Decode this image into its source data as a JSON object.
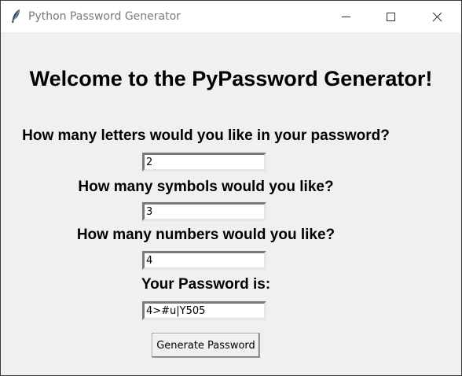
{
  "window": {
    "title": "Python Password Generator",
    "app_icon": "feather-icon",
    "controls": [
      "minimize-icon",
      "maximize-icon",
      "close-icon"
    ]
  },
  "main": {
    "heading": "Welcome to the PyPassword Generator!",
    "letters_label": "How many letters would you like in your password?",
    "letters_value": "2",
    "symbols_label": "How many symbols would you like?",
    "symbols_value": "3",
    "numbers_label": "How many numbers would you like?",
    "numbers_value": "4",
    "password_label": "Your Password is:",
    "password_value": "4>#u|Y505",
    "generate_button_label": "Generate Password"
  }
}
